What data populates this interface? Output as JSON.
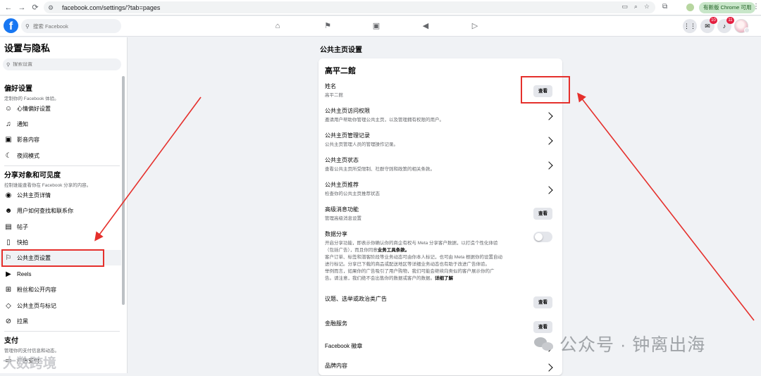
{
  "browser": {
    "url": "facebook.com/settings/?tab=pages",
    "update_label": "有新版 Chrome 可用"
  },
  "fb_header": {
    "logo": "f",
    "search_placeholder": "搜索 Facebook",
    "nav_icons": [
      "home-icon",
      "flag-icon",
      "marketplace-icon",
      "megaphone-icon",
      "video-icon"
    ],
    "messenger_badge": "10",
    "notification_badge": "11"
  },
  "sidebar": {
    "title": "设置与隐私",
    "search_placeholder": "搜索设置",
    "sections": [
      {
        "heading": "偏好设置",
        "desc": "定制你的 Facebook 体验。",
        "items": [
          {
            "icon": "reaction-icon",
            "label": "心情偏好设置"
          },
          {
            "icon": "bell-icon",
            "label": "通知"
          },
          {
            "icon": "media-icon",
            "label": "影音内容"
          },
          {
            "icon": "moon-icon",
            "label": "夜间模式"
          }
        ]
      },
      {
        "heading": "分享对象和可见度",
        "desc": "控制谁能查看你在 Facebook 分享的内容。",
        "items": [
          {
            "icon": "profile-icon",
            "label": "公共主页详情"
          },
          {
            "icon": "people-icon",
            "label": "用户如何查找和联系你"
          },
          {
            "icon": "post-icon",
            "label": "帖子"
          },
          {
            "icon": "stories-icon",
            "label": "快拍"
          },
          {
            "icon": "flag-icon",
            "label": "公共主页设置"
          },
          {
            "icon": "reels-icon",
            "label": "Reels"
          },
          {
            "icon": "followers-icon",
            "label": "粉丝和公开内容"
          },
          {
            "icon": "tag-icon",
            "label": "公共主页与标记"
          },
          {
            "icon": "block-icon",
            "label": "拉黑"
          }
        ]
      },
      {
        "heading": "支付",
        "desc": "管理你的支付信息和动态。",
        "items": [
          {
            "icon": "card-icon",
            "label": "广告支付"
          }
        ]
      }
    ],
    "active_item": "公共主页设置"
  },
  "main": {
    "title": "公共主页设置",
    "card_title": "高平二館",
    "rows": [
      {
        "title": "姓名",
        "desc": "高平二館",
        "action": "button",
        "action_label": "查看"
      },
      {
        "title": "公共主页访问权限",
        "desc": "邀请用户帮助你管理公共主页，以及管理拥有权限的用户。",
        "action": "chevron"
      },
      {
        "title": "公共主页管理记录",
        "desc": "公共主页管理人员的管理操作记录。",
        "action": "chevron"
      },
      {
        "title": "公共主页状态",
        "desc": "查看公共主页所受限制、社群守则和政策的相关条款。",
        "action": "chevron"
      },
      {
        "title": "公共主页推荐",
        "desc": "检查你的公共主页推荐状态",
        "action": "chevron"
      },
      {
        "title": "高级消息功能",
        "desc": "管理高级消息设置",
        "action": "button",
        "action_label": "查看"
      },
      {
        "title": "数据分享",
        "desc_lines": [
          "开启分享功能，即表示你确认你的商企有权与 Meta 分享客户数据，以打造个性化体验",
          "（包括广告），而且你同意"
        ],
        "desc_bold_1": "业务工具条款。",
        "desc_tail": [
          "客户订单、标签和潜客阶段等业务动态可由你本人标记，也可由 Meta 根据你的设置自动",
          "进行标记。分享已下载的商品或配送地区等详细业务动态也有助于改进广告体验。",
          "举例而言，如果你的广告吸引了用户购物，我们可能会继续向类似的客户展示你的广",
          "告。请注意，我们绝不会出售你的数据或客户的数据。"
        ],
        "desc_bold_2": "详细了解",
        "action": "toggle",
        "toggle_on": false
      },
      {
        "title": "议题、选举或政治类广告",
        "action": "button",
        "action_label": "查看"
      },
      {
        "title": "金融服务",
        "action": "button",
        "action_label": "查看"
      },
      {
        "title": "Facebook 徽章",
        "action": "chevron"
      },
      {
        "title": "品牌内容",
        "action": "chevron"
      }
    ]
  },
  "watermarks": {
    "right": "公众号 · 钟离出海",
    "left": "大数跨境"
  },
  "colors": {
    "facebook_blue": "#1877f2",
    "highlight_red": "#e5302c",
    "badge_red": "#e41e3f"
  }
}
